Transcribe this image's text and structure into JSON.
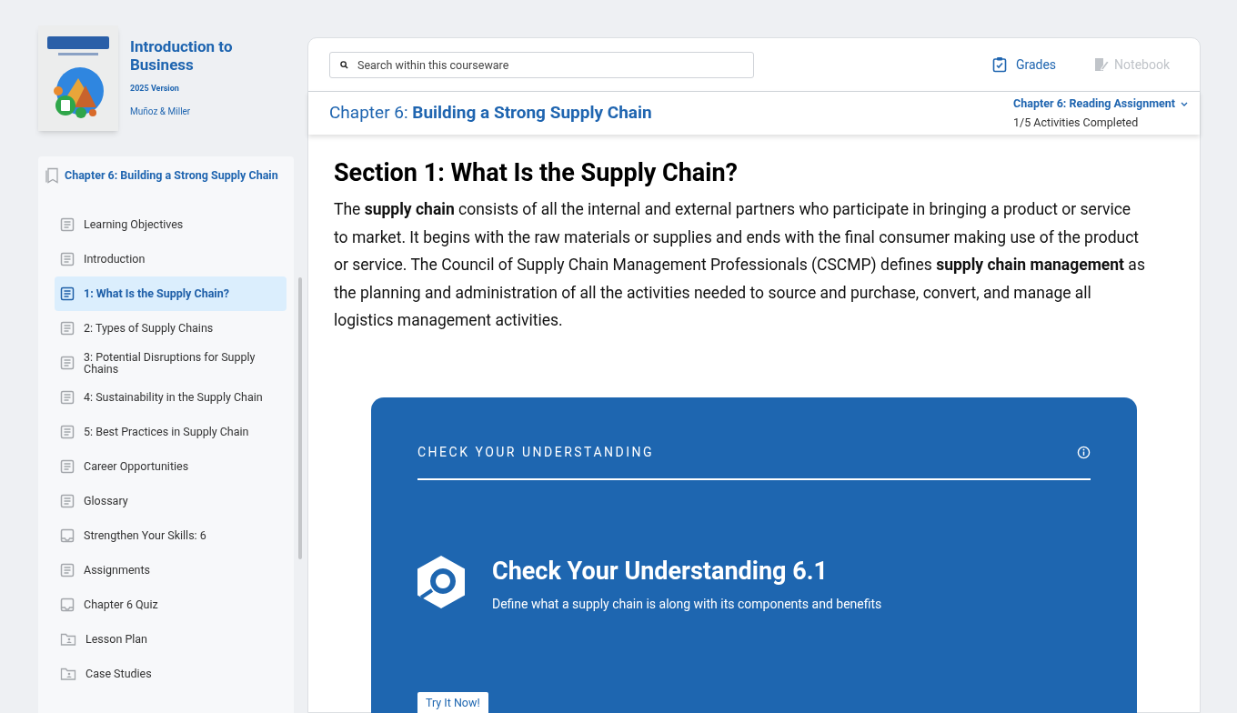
{
  "book": {
    "title": "Introduction to Business",
    "version": "2025 Version",
    "authors": "Muñoz & Miller"
  },
  "sidebar": {
    "chapter": "Chapter 6: Building a Strong Supply Chain",
    "items": [
      {
        "label": "Learning Objectives",
        "kind": "page",
        "selected": false
      },
      {
        "label": "Introduction",
        "kind": "page",
        "selected": false
      },
      {
        "label": "1: What Is the Supply Chain?",
        "kind": "page",
        "selected": true
      },
      {
        "label": "2: Types of Supply Chains",
        "kind": "page",
        "selected": false
      },
      {
        "label": "3: Potential Disruptions for Supply Chains",
        "kind": "page",
        "selected": false
      },
      {
        "label": "4: Sustainability in the Supply Chain",
        "kind": "page",
        "selected": false
      },
      {
        "label": "5: Best Practices in Supply Chain",
        "kind": "page",
        "selected": false
      },
      {
        "label": "Career Opportunities",
        "kind": "page",
        "selected": false
      },
      {
        "label": "Glossary",
        "kind": "page",
        "selected": false
      },
      {
        "label": "Strengthen Your Skills: 6",
        "kind": "quiz",
        "selected": false
      },
      {
        "label": "Assignments",
        "kind": "page",
        "selected": false
      },
      {
        "label": "Chapter 6 Quiz",
        "kind": "quiz",
        "selected": false
      },
      {
        "label": "Lesson Plan",
        "kind": "folder",
        "selected": false
      },
      {
        "label": "Case Studies",
        "kind": "folder",
        "selected": false
      }
    ]
  },
  "toolbar": {
    "search": {
      "placeholder": "Search within this courseware"
    },
    "grades": {
      "label": "Grades",
      "disabled": false
    },
    "notebook": {
      "label": "Notebook",
      "disabled": true
    }
  },
  "chapter_bar": {
    "prefix": "Chapter 6:",
    "title": "Building a Strong Supply Chain",
    "assignment": "Chapter 6: Reading Assignment",
    "progress": "1/5 Activities Completed"
  },
  "content": {
    "heading": "Section 1: What Is the Supply Chain?",
    "paragraph": "The **supply chain** consists of all the internal and external partners who participate in bringing a product or service to market. It begins with the raw materials or supplies and ends with the final consumer making use of the product or service. The Council of Supply Chain Management Professionals (CSCMP) defines **supply chain management** as the planning and administration of all the activities needed to source and purchase, convert, and manage all logistics management activities.",
    "card": {
      "label": "CHECK YOUR UNDERSTANDING",
      "title": "Check Your Understanding 6.1",
      "description": "Define what a supply chain is along with its components and benefits",
      "button": "Try It Now!"
    }
  }
}
